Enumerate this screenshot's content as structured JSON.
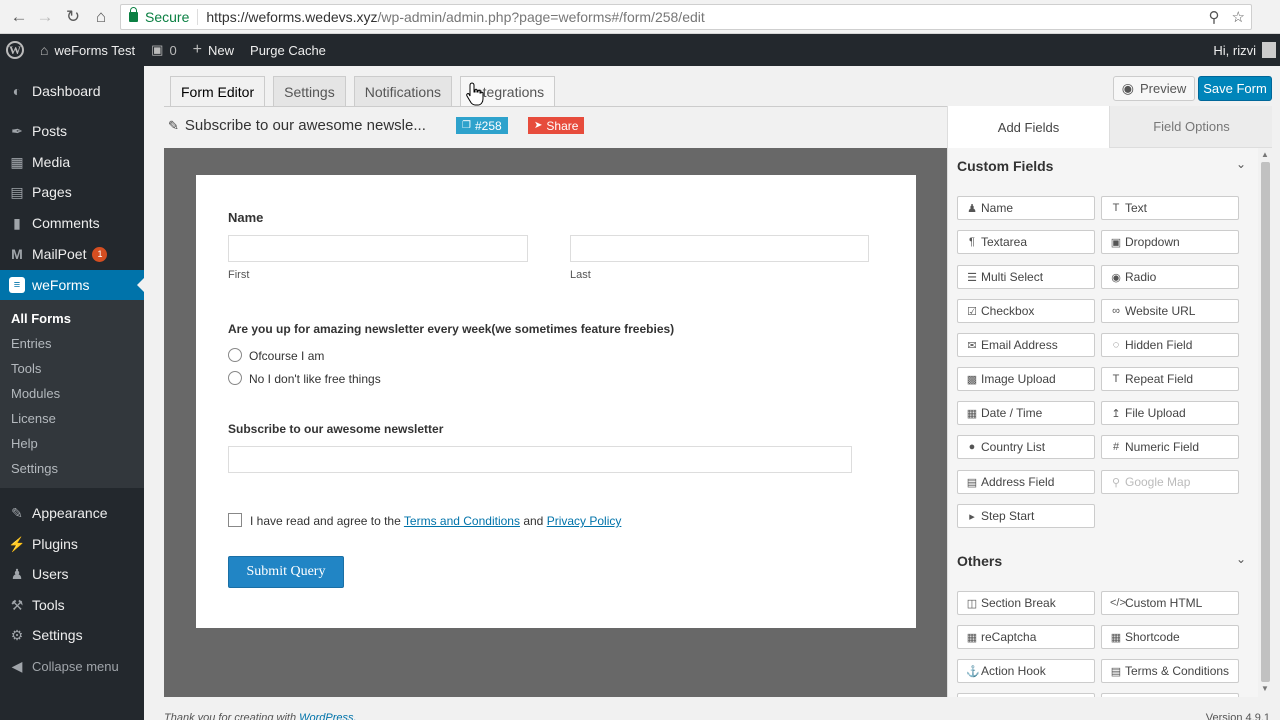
{
  "browser": {
    "secure_label": "Secure",
    "url_main": "https://weforms.wedevs.xyz",
    "url_rest": "/wp-admin/admin.php?page=weforms#/form/258/edit"
  },
  "adminbar": {
    "site_name": "weForms Test",
    "comments_count": "0",
    "new_label": "New",
    "purge_label": "Purge Cache",
    "greeting": "Hi, rizvi"
  },
  "sidebar": {
    "items": [
      {
        "label": "Dashboard",
        "icon": "dashboard-icon"
      },
      {
        "label": "Posts",
        "icon": "pushpin-icon"
      },
      {
        "label": "Media",
        "icon": "media-icon"
      },
      {
        "label": "Pages",
        "icon": "pages-icon"
      },
      {
        "label": "Comments",
        "icon": "comments-icon"
      },
      {
        "label": "MailPoet",
        "icon": "mailpoet-icon",
        "badge": "1"
      },
      {
        "label": "weForms",
        "icon": "weforms-icon"
      },
      {
        "label": "Appearance",
        "icon": "brush-icon"
      },
      {
        "label": "Plugins",
        "icon": "plugin-icon"
      },
      {
        "label": "Users",
        "icon": "users-icon"
      },
      {
        "label": "Tools",
        "icon": "wrench-icon"
      },
      {
        "label": "Settings",
        "icon": "settings-icon"
      },
      {
        "label": "Collapse menu",
        "icon": "collapse-icon"
      }
    ],
    "submenu": [
      "All Forms",
      "Entries",
      "Tools",
      "Modules",
      "License",
      "Help",
      "Settings"
    ]
  },
  "editor": {
    "tabs": [
      "Form Editor",
      "Settings",
      "Notifications",
      "Integrations"
    ],
    "preview_label": "Preview",
    "save_label": "Save Form",
    "form_title": "Subscribe to our awesome newsle...",
    "form_id": "#258",
    "share_label": "Share"
  },
  "form": {
    "name_label": "Name",
    "first_label": "First",
    "last_label": "Last",
    "question": "Are you up for amazing newsletter every week(we sometimes feature freebies)",
    "options": [
      "Ofcourse I am",
      "No I don't like free things"
    ],
    "subscribe_label": "Subscribe to our awesome newsletter",
    "terms_prefix": "I have read and agree to the",
    "terms_link": "Terms and Conditions",
    "terms_and": "and",
    "privacy_link": "Privacy Policy",
    "submit_label": "Submit Query"
  },
  "footer": {
    "text": "Thank you for creating with",
    "link": "WordPress.",
    "version": "Version 4.9.1"
  },
  "panel": {
    "tab_add": "Add Fields",
    "tab_options": "Field Options",
    "custom_title": "Custom Fields",
    "custom_fields": [
      {
        "label": "Name",
        "icon": "user-icon"
      },
      {
        "label": "Text",
        "icon": "text-icon"
      },
      {
        "label": "Textarea",
        "icon": "paragraph-icon"
      },
      {
        "label": "Dropdown",
        "icon": "dropdown-icon"
      },
      {
        "label": "Multi Select",
        "icon": "list-icon"
      },
      {
        "label": "Radio",
        "icon": "radio-icon"
      },
      {
        "label": "Checkbox",
        "icon": "checkbox-icon"
      },
      {
        "label": "Website URL",
        "icon": "link-icon"
      },
      {
        "label": "Email Address",
        "icon": "envelope-icon"
      },
      {
        "label": "Hidden Field",
        "icon": "eye-slash-icon"
      },
      {
        "label": "Image Upload",
        "icon": "image-icon"
      },
      {
        "label": "Repeat Field",
        "icon": "text-icon"
      },
      {
        "label": "Date / Time",
        "icon": "calendar-icon"
      },
      {
        "label": "File Upload",
        "icon": "upload-icon"
      },
      {
        "label": "Country List",
        "icon": "globe-icon"
      },
      {
        "label": "Numeric Field",
        "icon": "hash-icon"
      },
      {
        "label": "Address Field",
        "icon": "address-card-icon"
      },
      {
        "label": "Google Map",
        "icon": "map-marker-icon",
        "disabled": true
      },
      {
        "label": "Step Start",
        "icon": "step-icon"
      }
    ],
    "others_title": "Others",
    "other_fields": [
      {
        "label": "Section Break",
        "icon": "columns-icon"
      },
      {
        "label": "Custom HTML",
        "icon": "code-icon"
      },
      {
        "label": "reCaptcha",
        "icon": "qrcode-icon"
      },
      {
        "label": "Shortcode",
        "icon": "calendar-icon"
      },
      {
        "label": "Action Hook",
        "icon": "anchor-icon"
      },
      {
        "label": "Terms & Conditions",
        "icon": "file-icon"
      }
    ]
  },
  "colors": {
    "admin_dark": "#23282d",
    "accent_blue": "#0073aa",
    "save_blue": "#0085ba",
    "share_red": "#e74c3c",
    "id_blue": "#2ea2cc"
  }
}
